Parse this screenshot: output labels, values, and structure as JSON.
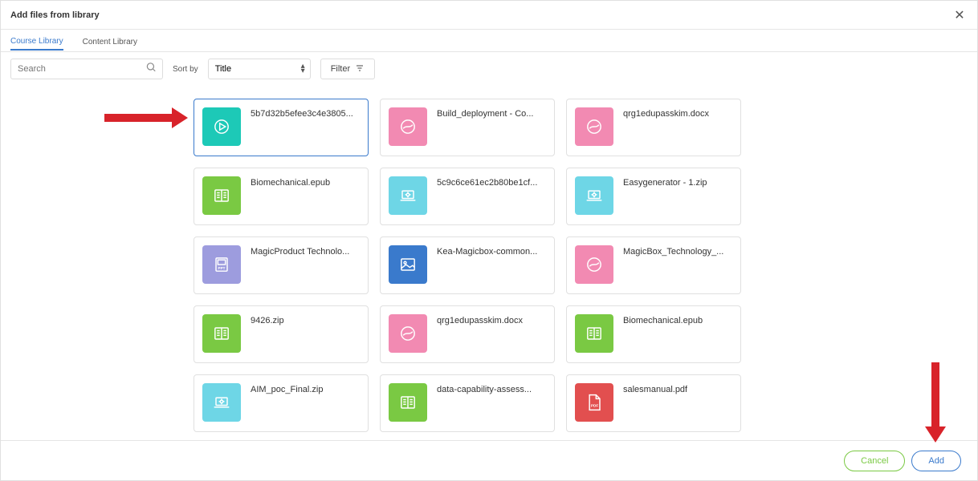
{
  "header": {
    "title": "Add files from library"
  },
  "tabs": [
    {
      "label": "Course Library",
      "active": true
    },
    {
      "label": "Content Library",
      "active": false
    }
  ],
  "search": {
    "placeholder": "Search"
  },
  "sort": {
    "label": "Sort by",
    "value": "Title"
  },
  "filter": {
    "label": "Filter"
  },
  "files": [
    {
      "name": "5b7d32b5efee3c4e3805...",
      "icon": "play",
      "color": "teal",
      "selected": true
    },
    {
      "name": "Build_deployment - Co...",
      "icon": "scorm",
      "color": "pink"
    },
    {
      "name": "qrg1edupasskim.docx",
      "icon": "scorm",
      "color": "pink"
    },
    {
      "name": "Biomechanical.epub",
      "icon": "book",
      "color": "green"
    },
    {
      "name": "5c9c6ce61ec2b80be1cf...",
      "icon": "laptop",
      "color": "cyan"
    },
    {
      "name": "Easygenerator - 1.zip",
      "icon": "laptop",
      "color": "cyan"
    },
    {
      "name": "MagicProduct Technolo...",
      "icon": "ppt",
      "color": "purple"
    },
    {
      "name": "Kea-Magicbox-common...",
      "icon": "image",
      "color": "blue"
    },
    {
      "name": "MagicBox_Technology_...",
      "icon": "scorm",
      "color": "pink"
    },
    {
      "name": "9426.zip",
      "icon": "book",
      "color": "green"
    },
    {
      "name": "qrg1edupasskim.docx",
      "icon": "scorm",
      "color": "pink"
    },
    {
      "name": "Biomechanical.epub",
      "icon": "book",
      "color": "green"
    },
    {
      "name": "AIM_poc_Final.zip",
      "icon": "laptop",
      "color": "cyan"
    },
    {
      "name": "data-capability-assess...",
      "icon": "book",
      "color": "green"
    },
    {
      "name": "salesmanual.pdf",
      "icon": "pdf",
      "color": "red"
    }
  ],
  "footer": {
    "cancel": "Cancel",
    "add": "Add"
  }
}
